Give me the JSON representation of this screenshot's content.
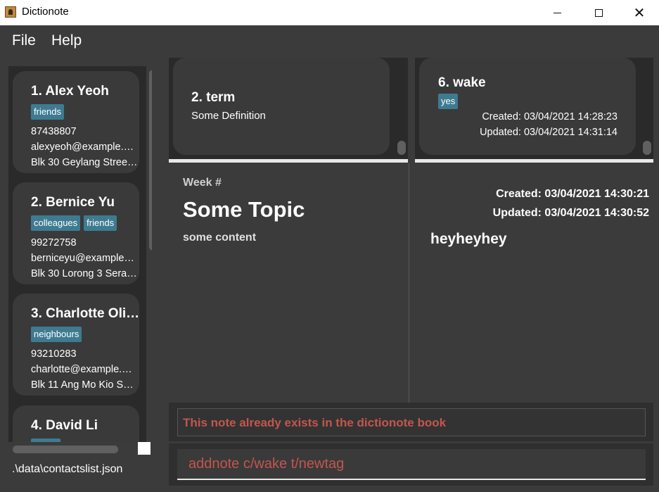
{
  "window": {
    "title": "Dictionote"
  },
  "menu": {
    "file": "File",
    "help": "Help"
  },
  "contacts": [
    {
      "name": "1.  Alex Yeoh",
      "tags": [
        "friends"
      ],
      "phone": "87438807",
      "email": "alexyeoh@example.…",
      "address": "Blk 30 Geylang Stree…"
    },
    {
      "name": "2.  Bernice Yu",
      "tags": [
        "colleagues",
        "friends"
      ],
      "phone": "99272758",
      "email": "berniceyu@example…",
      "address": "Blk 30 Lorong 3 Sera…"
    },
    {
      "name": "3.  Charlotte Oli…",
      "tags": [
        "neighbours"
      ],
      "phone": "93210283",
      "email": "charlotte@example.…",
      "address": "Blk 11 Ang Mo Kio S…"
    },
    {
      "name": "4.  David Li",
      "tags": [
        "family"
      ],
      "phone": "",
      "email": "",
      "address": ""
    }
  ],
  "status": {
    "path": ".\\data\\contactslist.json"
  },
  "definition_card": {
    "title": "2.  term",
    "definition": "Some Definition"
  },
  "note_card": {
    "title": "6.  wake",
    "tag": "yes",
    "created": "Created: 03/04/2021 14:28:23",
    "updated": "Updated: 03/04/2021 14:31:14"
  },
  "content_view": {
    "week": "Week #",
    "topic": "Some Topic",
    "content": "some content"
  },
  "note_view": {
    "created": "Created: 03/04/2021 14:30:21",
    "updated": "Updated: 03/04/2021 14:30:52",
    "body": "heyheyhey"
  },
  "result": {
    "message": "This note already exists in the dictionote book"
  },
  "command": {
    "value": "addnote c/wake t/newtag"
  }
}
